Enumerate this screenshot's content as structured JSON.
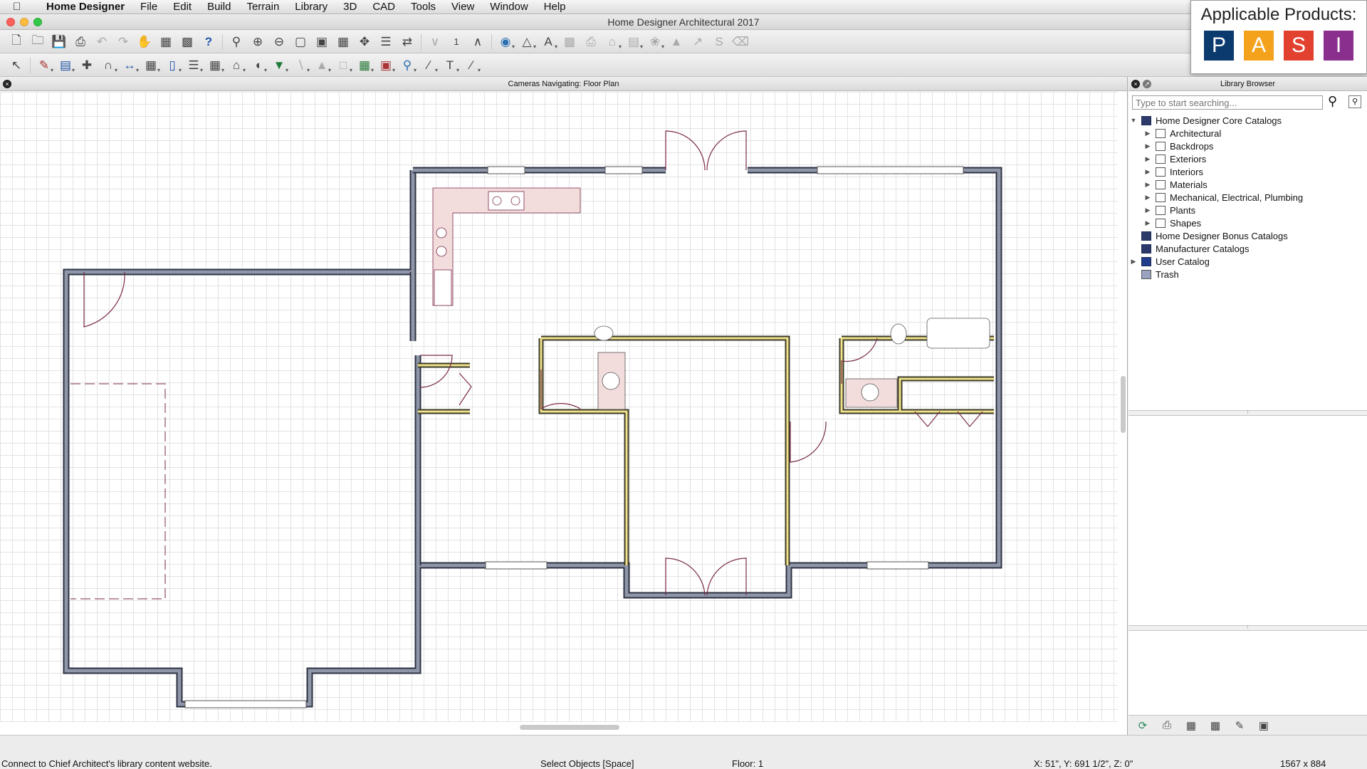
{
  "menubar": {
    "app_name": "Home Designer",
    "items": [
      "File",
      "Edit",
      "Build",
      "Terrain",
      "Library",
      "3D",
      "CAD",
      "Tools",
      "View",
      "Window",
      "Help"
    ]
  },
  "window": {
    "title": "Home Designer Architectural 2017"
  },
  "toolbar": {
    "row1": [
      "new-file-icon",
      "open-file-icon",
      "save-icon",
      "print-icon",
      "undo-icon",
      "redo-icon",
      "hand-icon",
      "layout-icon",
      "select-layout-icon",
      "help-icon",
      "zoom-window-icon",
      "zoom-in-icon",
      "zoom-out-icon",
      "fill-window-icon",
      "fit-plan-icon",
      "fill-all-icon",
      "pan-icon",
      "layers-icon",
      "reference-icon",
      "floor-down-icon",
      "floor-number",
      "floor-up-icon",
      "camera-icon",
      "elevation-icon",
      "text-style-icon",
      "render-icon",
      "print-3d-icon",
      "roof-icon",
      "deck-icon",
      "plant-icon",
      "terrain-icon",
      "measure-icon",
      "spline-icon",
      "eraser-icon"
    ],
    "floor_number": "1"
  },
  "products": {
    "title": "Applicable Products:",
    "badges": [
      {
        "letter": "P",
        "color": "#0b3a6e"
      },
      {
        "letter": "A",
        "color": "#f4a21c"
      },
      {
        "letter": "S",
        "color": "#e2412f"
      },
      {
        "letter": "I",
        "color": "#8a2f8e"
      }
    ]
  },
  "plan": {
    "panel_title": "Cameras Navigating: Floor Plan"
  },
  "library": {
    "title": "Library Browser",
    "search_placeholder": "Type to start searching...",
    "root": "Home Designer Core Catalogs",
    "core_children": [
      "Architectural",
      "Backdrops",
      "Exteriors",
      "Interiors",
      "Materials",
      "Mechanical, Electrical, Plumbing",
      "Plants",
      "Shapes"
    ],
    "other_roots": [
      "Home Designer Bonus Catalogs",
      "Manufacturer Catalogs",
      "User Catalog",
      "Trash"
    ]
  },
  "status": {
    "hint": "Connect to Chief Architect's library content website.",
    "mode": "Select Objects [Space]",
    "floor": "Floor: 1",
    "coords": "X: 51\", Y: 691 1/2\", Z: 0\"",
    "size": "1567 x 884"
  },
  "colors": {
    "exterior_wall": "#8f96a8",
    "interior_wall": "#f0e28a",
    "door_line": "#7a2a4a",
    "cabinet": "#f2dcdc"
  }
}
